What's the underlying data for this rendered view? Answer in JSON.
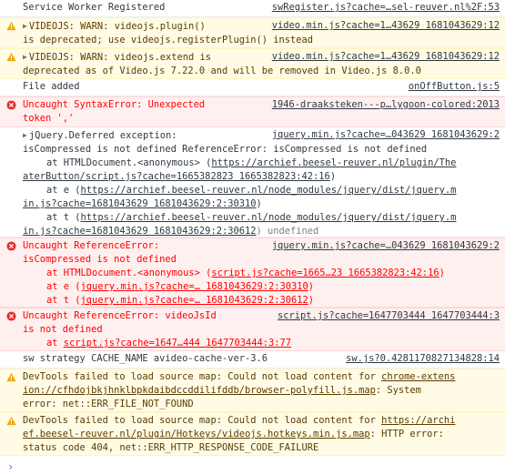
{
  "console": {
    "messages": [
      {
        "type": "info",
        "text": "Service Worker Registered",
        "source": "swRegister.js?cache=…sel-reuver.nl%2F:53"
      },
      {
        "type": "warn",
        "source": "video.min.js?cache=1…43629 1681043629:12",
        "line1": "VIDEOJS: WARN: videojs.plugin()",
        "line2": "is deprecated; use videojs.registerPlugin() instead"
      },
      {
        "type": "warn",
        "source": "video.min.js?cache=1…43629 1681043629:12",
        "line1": "VIDEOJS: WARN: videojs.extend is",
        "line2": "deprecated as of Video.js 7.22.0 and will be removed in Video.js 8.0.0"
      },
      {
        "type": "info",
        "text": "File added",
        "source": "onOffButton.js:5"
      },
      {
        "type": "error",
        "line1": "Uncaught SyntaxError: Unexpected",
        "line2": "token ','",
        "source": "1946-draaksteken---p…lygoon-colored:2013"
      },
      {
        "type": "info",
        "source": "jquery.min.js?cache=…043629 1681043629:2",
        "line1": "jQuery.Deferred exception:",
        "line2": "isCompressed is not defined ReferenceError: isCompressed is not defined",
        "trace": [
          {
            "prefix": "at HTMLDocument.<anonymous> (",
            "link": "https://archief.beesel-reuver.nl/plugin/The",
            "suffix": ""
          },
          {
            "prefix": "",
            "link": "aterButton/script.js?cache=1665382823 1665382823:42:16",
            "suffix": ")"
          },
          {
            "prefix": "at e (",
            "link": "https://archief.beesel-reuver.nl/node_modules/jquery/dist/jquery.m",
            "suffix": ""
          },
          {
            "prefix": "",
            "link": "in.js?cache=1681043629 1681043629:2:30310",
            "suffix": ")"
          },
          {
            "prefix": "at t (",
            "link": "https://archief.beesel-reuver.nl/node_modules/jquery/dist/jquery.m",
            "suffix": ""
          },
          {
            "prefix": "",
            "link": "in.js?cache=1681043629 1681043629:2:30612",
            "suffix": ") undefined"
          }
        ]
      },
      {
        "type": "error",
        "line1": "Uncaught ReferenceError:",
        "line2": "isCompressed is not defined",
        "source": "jquery.min.js?cache=…043629 1681043629:2",
        "trace": [
          {
            "prefix": "at HTMLDocument.<anonymous> (",
            "link": "script.js?cache=1665…23 1665382823:42:16",
            "suffix": ")"
          },
          {
            "prefix": "at e (",
            "link": "jquery.min.js?cache=… 1681043629:2:30310",
            "suffix": ")"
          },
          {
            "prefix": "at t (",
            "link": "jquery.min.js?cache=… 1681043629:2:30612",
            "suffix": ")"
          }
        ]
      },
      {
        "type": "error",
        "line1": "Uncaught ReferenceError: videoJsId",
        "line2": "is not defined",
        "source": "script.js?cache=1647703444 1647703444:3",
        "trace": [
          {
            "prefix": "at ",
            "link": "script.js?cache=1647…444 1647703444:3:77",
            "suffix": ""
          }
        ]
      },
      {
        "type": "info",
        "text": "sw strategy CACHE_NAME avideo-cache-ver-3.6",
        "source": "sw.js?0.4281170827134828:14"
      },
      {
        "type": "warn",
        "line1_prefix": "DevTools failed to load source map: Could not load content for ",
        "line1_link": "chrome-extens",
        "line2_link": "ion://cfhdojbkjhnklbpkdaibdccddilifddb/browser-polyfill.js.map",
        "line2_suffix": ": System",
        "line3": "error: net::ERR_FILE_NOT_FOUND"
      },
      {
        "type": "warn",
        "line1_prefix": "DevTools failed to load source map: Could not load content for ",
        "line1_link": "https://archi",
        "line2_link": "ef.beesel-reuver.nl/plugin/Hotkeys/videojs.hotkeys.min.js.map",
        "line2_suffix": ": HTTP error:",
        "line3": "status code 404, net::ERR_HTTP_RESPONSE_CODE_FAILURE"
      }
    ],
    "prompt_symbol": "›"
  },
  "colors": {
    "warn_bg": "#fffbe5",
    "warn_text": "#5c3c00",
    "error_bg": "#fff0f0",
    "error_text": "#ff0000",
    "prompt": "#367cf1"
  },
  "icons": {
    "warning": "warning-triangle-icon",
    "error": "error-circle-icon",
    "expand": "expand-triangle-icon"
  }
}
